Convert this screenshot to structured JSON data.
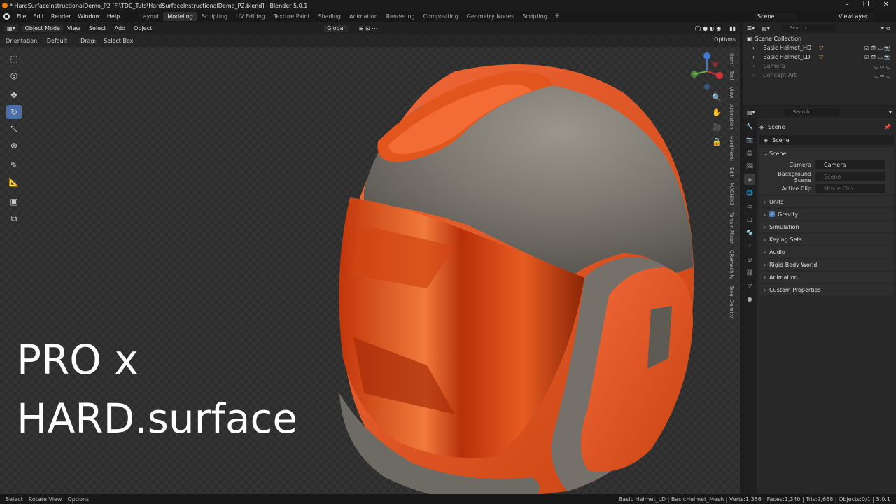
{
  "window": {
    "title": "* HardSurfaceInstructionalDemo_P2 [F:\\TDC_Tuts\\HardSurfaceInstructionalDemo_P2.blend] - Blender 5.0.1"
  },
  "menu": {
    "items": [
      "File",
      "Edit",
      "Render",
      "Window",
      "Help"
    ]
  },
  "workspaces": [
    "Layout",
    "Modeling",
    "Sculpting",
    "UV Editing",
    "Texture Paint",
    "Shading",
    "Animation",
    "Rendering",
    "Compositing",
    "Geometry Nodes",
    "Scripting"
  ],
  "active_workspace": "Modeling",
  "top_right": {
    "scene": "Scene",
    "view_layer": "ViewLayer"
  },
  "viewport": {
    "mode": "Object Mode",
    "menus": [
      "View",
      "Select",
      "Add",
      "Object"
    ],
    "transform": "Global",
    "orientation_label": "Orientation:",
    "orientation_value": "Default",
    "drag_label": "Drag:",
    "drag_value": "Select Box",
    "options": "Options",
    "n_tabs": [
      "Item",
      "Tool",
      "View",
      "Animation",
      "HardMenu",
      "Edit",
      "MACHIN3",
      "Terrain Mixer",
      "QRemeshify",
      "Texel Density"
    ],
    "overlay_line1": "PRO x",
    "overlay_line2": "HARD.surface"
  },
  "outliner": {
    "search_placeholder": "Search",
    "root": "Scene Collection",
    "items": [
      {
        "label": "Basic Helmet_HD",
        "dim": false
      },
      {
        "label": "Basic Helmet_LD",
        "dim": false
      },
      {
        "label": "Camera",
        "dim": true
      },
      {
        "label": "Concept Art",
        "dim": true
      }
    ]
  },
  "properties": {
    "search_placeholder": "Search",
    "context": "Scene",
    "scene_field": "Scene",
    "scene_panel": "Scene",
    "camera_label": "Camera",
    "camera_value": "Camera",
    "bg_label": "Background Scene",
    "bg_value": "Scene",
    "clip_label": "Active Clip",
    "clip_value": "Movie Clip",
    "panels": [
      "Units",
      "Gravity",
      "Simulation",
      "Keying Sets",
      "Audio",
      "Rigid Body World",
      "Animation",
      "Custom Properties"
    ]
  },
  "status": {
    "select": "Select",
    "rotate": "Rotate View",
    "options": "Options",
    "stats": "Basic Helmet_LD | BasicHelmet_Mesh | Verts:1,356 | Faces:1,340 | Tris:2,668 | Objects:0/1 | 5.0.1"
  },
  "colors": {
    "accent": "#4b6fa8",
    "helmet_orange": "#e0521c",
    "helmet_grey": "#7c7870"
  }
}
